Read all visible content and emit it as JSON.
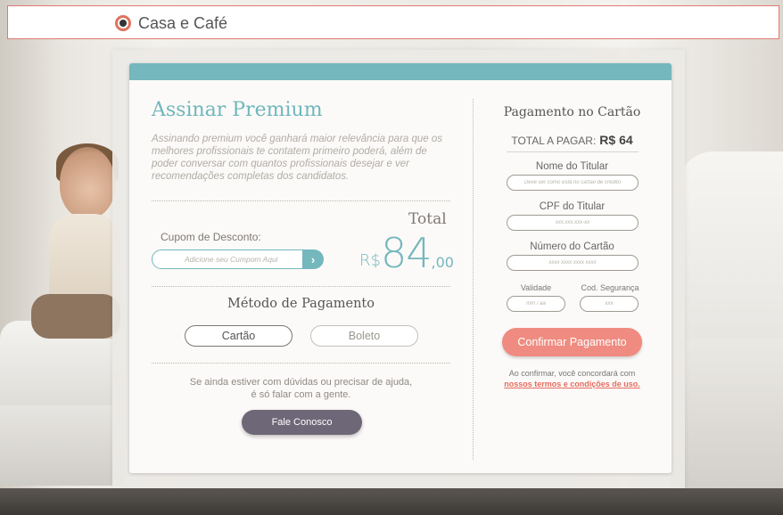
{
  "header": {
    "brand": "Casa e Café"
  },
  "left": {
    "title": "Assinar Premium",
    "description": "Assinando premium você ganhará maior relevância para que os melhores profissionais te contatem primeiro poderá, além de poder conversar com quantos profissionais desejar e ver recomendações completas dos candidatos.",
    "total_label": "Total",
    "coupon_label": "Cupom de Desconto:",
    "coupon_placeholder": "Adicione seu Cumpom Aqui",
    "coupon_submit_icon": "chevron-right-icon",
    "price": {
      "currency": "R$",
      "amount": "84",
      "cents": ",00"
    },
    "method_title": "Método de Pagamento",
    "methods": [
      "Cartão",
      "Boleto"
    ],
    "selected_method": "Cartão",
    "help_line1": "Se ainda estiver com dúvidas ou precisar de ajuda,",
    "help_line2": "é só falar com a gente.",
    "contact_button": "Fale Conosco"
  },
  "right": {
    "title": "Pagamento no Cartão",
    "total_to_pay_label": "TOTAL A PAGAR:",
    "total_to_pay_value": "R$ 64",
    "fields": {
      "holder_name_label": "Nome do Titular",
      "holder_name_placeholder": "Deve ser como está no cartão de crédito",
      "holder_cpf_label": "CPF do Titular",
      "holder_cpf_placeholder": "xxx.xxx.xxx-xx",
      "card_number_label": "Número do Cartão",
      "card_number_placeholder": "xxxx xxxx xxxx xxxx",
      "validity_label": "Validade",
      "validity_placeholder": "mm / aa",
      "security_code_label": "Cod. Segurança",
      "security_code_placeholder": "xxx"
    },
    "confirm_button": "Confirmar Pagamento",
    "terms_text": "Ao confirmar, você concordará com",
    "terms_link": "nossos termos e condições de uso."
  },
  "colors": {
    "accent_teal": "#74b7bd",
    "confirm_coral": "#ef8b80",
    "contact_purple": "#6e6777",
    "link_red": "#e66b5e"
  }
}
